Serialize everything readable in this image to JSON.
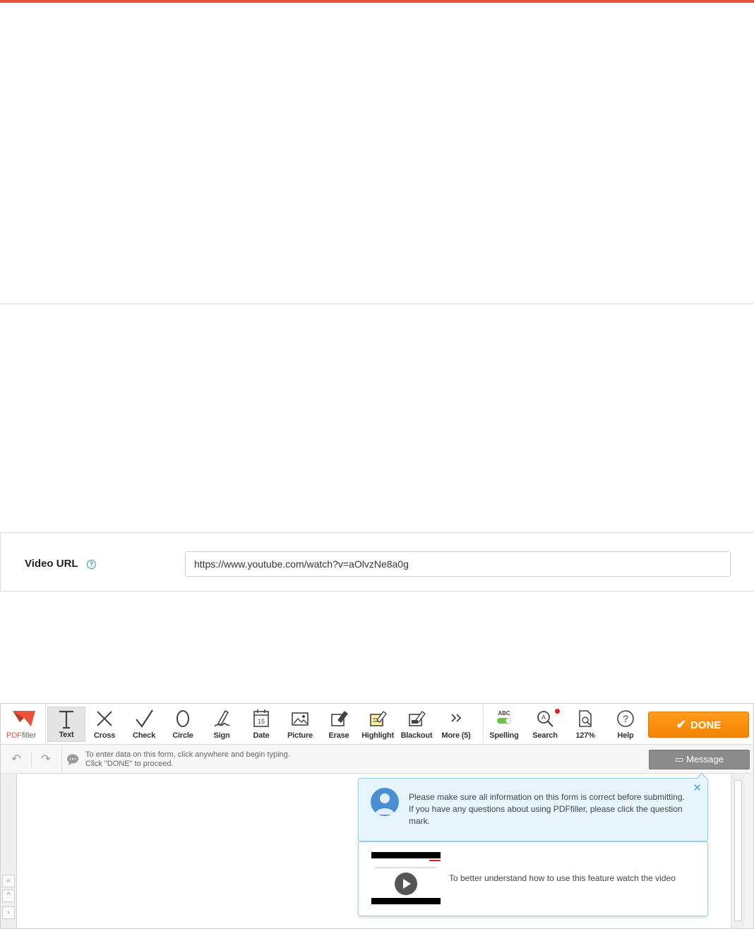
{
  "video_url": {
    "label": "Video URL",
    "help_icon": "question-icon",
    "value": "https://www.youtube.com/watch?v=aOlvzNe8a0g"
  },
  "editor": {
    "logo": {
      "pdf": "PDF",
      "filler": "filler"
    },
    "tools": [
      {
        "label": "Text",
        "icon": "text-icon"
      },
      {
        "label": "Cross",
        "icon": "cross-icon"
      },
      {
        "label": "Check",
        "icon": "check-icon"
      },
      {
        "label": "Circle",
        "icon": "circle-icon"
      },
      {
        "label": "Sign",
        "icon": "sign-icon"
      },
      {
        "label": "Date",
        "icon": "date-icon",
        "day": "15"
      },
      {
        "label": "Picture",
        "icon": "picture-icon"
      },
      {
        "label": "Erase",
        "icon": "erase-icon"
      },
      {
        "label": "Highlight",
        "icon": "highlight-icon"
      },
      {
        "label": "Blackout",
        "icon": "blackout-icon"
      },
      {
        "label": "More (5)",
        "icon": "double-chevron-icon"
      },
      {
        "label": "Spelling",
        "icon": "spelling-toggle-icon",
        "abc": "ABC"
      },
      {
        "label": "Search",
        "icon": "search-icon"
      },
      {
        "label": "127%",
        "icon": "zoom-icon"
      },
      {
        "label": "Help",
        "icon": "help-icon"
      }
    ],
    "done_label": "DONE",
    "hint_line1": "To enter data on this form, click anywhere and begin typing.",
    "hint_line2": "Click \"DONE\" to proceed.",
    "message_label": "Message",
    "tooltip_text": "Please make sure all information on this form is correct before submitting. If you have any questions about using PDFfiller, please click the question mark.",
    "video_text": "To better understand how to use this feature watch the video",
    "colors": {
      "accent": "#e8533d",
      "done": "#f48200",
      "info_bg": "#e6f5fc"
    }
  }
}
